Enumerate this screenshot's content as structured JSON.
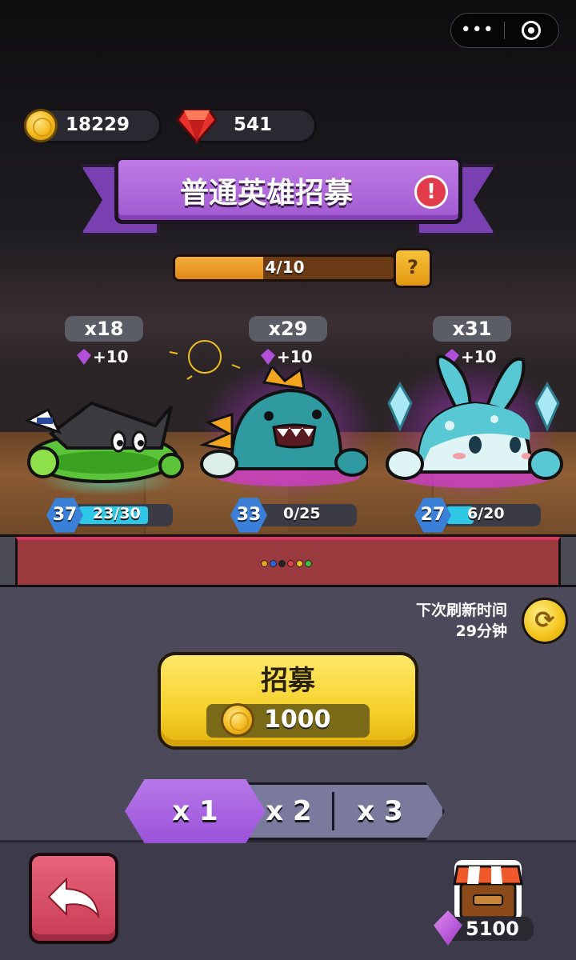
{
  "header": {
    "menu_dots": "•••",
    "coins": "18229",
    "gems": "541"
  },
  "title": {
    "text": "普通英雄招募",
    "alert": "!"
  },
  "progress": {
    "label": "4/10",
    "value": 0.4,
    "help": "?"
  },
  "heroes": [
    {
      "count": "x18",
      "bonus": "+10",
      "level": "37",
      "shards": "23/30",
      "shard_fill": 0.767,
      "color": "#59c23a"
    },
    {
      "count": "x29",
      "bonus": "+10",
      "level": "33",
      "shards": "0/25",
      "shard_fill": 0.0,
      "color": "#2f9aa0"
    },
    {
      "count": "x31",
      "bonus": "+10",
      "level": "27",
      "shards": "6/20",
      "shard_fill": 0.3,
      "color": "#58c8d4"
    }
  ],
  "page_dots": [
    "#f0a020",
    "#3060e0",
    "#222222",
    "#e04040",
    "#f0c020",
    "#40c040"
  ],
  "refresh": {
    "line1": "下次刷新时间",
    "line2": "29分钟"
  },
  "recruit": {
    "label": "招募",
    "cost": "1000"
  },
  "multipliers": [
    "x 1",
    "x 2",
    "x 3"
  ],
  "shop": {
    "gems": "5100"
  },
  "colors": {
    "accent_purple": "#a15ad0",
    "button_yellow": "#f6d12a",
    "back_red": "#c83c55"
  }
}
